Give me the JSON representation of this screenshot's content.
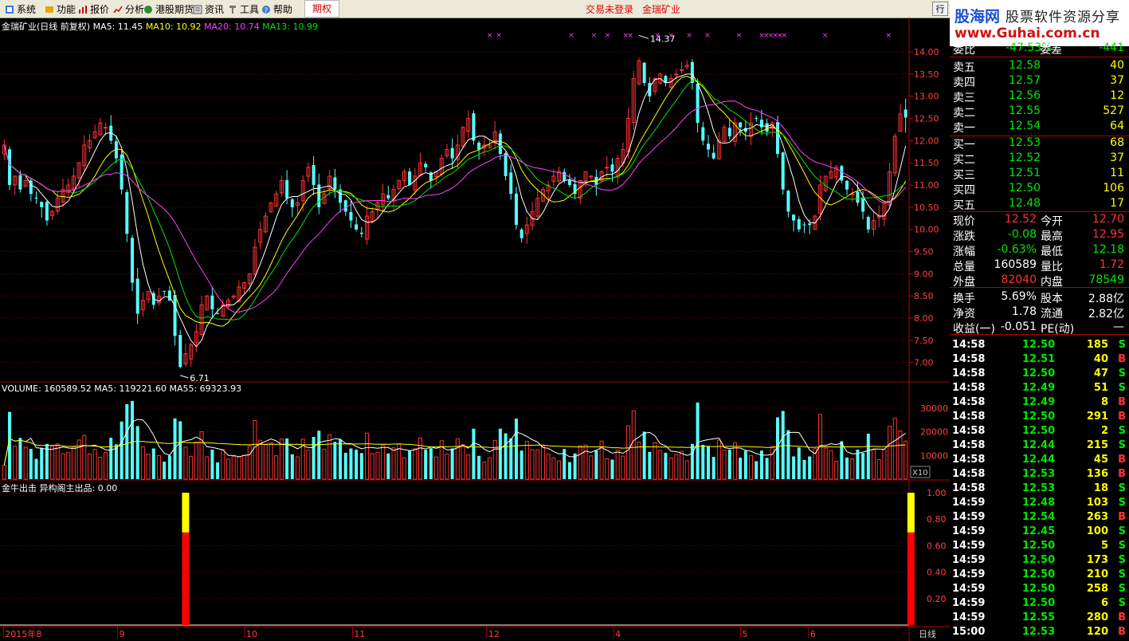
{
  "menu": {
    "items": [
      "系统",
      "功能",
      "报价",
      "分析",
      "港股期货",
      "资讯",
      "工具",
      "帮助"
    ],
    "active": "期权",
    "login_status": "交易未登录",
    "stock_name": "金瑞矿业",
    "top_button": "行"
  },
  "logo": {
    "brand": "股海网",
    "tagline": "股票软件资源分享",
    "url": "www.Guhai.com.cn"
  },
  "colors": {
    "up": "#ff3232",
    "down": "#54ffff",
    "ma5": "#ffffff",
    "ma10": "#ffff00",
    "ma20": "#ff40ff",
    "ma13": "#00e600",
    "grid": "#7a0000"
  },
  "price_panel": {
    "title": "金瑞矿业(日线 前复权)",
    "ma5": "MA5: 11.45",
    "ma10": "MA10: 10.92",
    "ma20": "MA20: 10.74",
    "ma13": "MA13: 10.99",
    "y_ticks": [
      "14.00",
      "13.50",
      "13.00",
      "12.50",
      "12.00",
      "11.50",
      "11.00",
      "10.50",
      "10.00",
      "9.50",
      "9.00",
      "8.50",
      "8.00",
      "7.50",
      "7.00"
    ],
    "y_range": [
      6.6,
      14.45
    ],
    "high_label": "14.37",
    "low_label": "6.71",
    "marker": "×"
  },
  "volume_panel": {
    "title": "VOLUME: 160589.52",
    "ma5": "MA5: 119221.60",
    "ma55": "MA55: 69323.93",
    "y_ticks": [
      "30000",
      "20000",
      "10000"
    ],
    "unit": "X10",
    "y_max": 36000
  },
  "indicator_panel": {
    "title": "金牛出击",
    "subtitle": "异构阁主出品: 0.00",
    "y_ticks": [
      "1.00",
      "0.80",
      "0.60",
      "0.40",
      "0.20"
    ]
  },
  "x_axis": {
    "labels": [
      "2015年8",
      "9",
      "10",
      "11",
      "12",
      "4",
      "5",
      "6"
    ],
    "period": "日线"
  },
  "chart_data": {
    "type": "candlestick",
    "close": [
      11.9,
      11.0,
      11.2,
      10.9,
      11.1,
      10.8,
      10.7,
      10.5,
      10.2,
      10.4,
      10.7,
      10.9,
      11.0,
      11.2,
      11.5,
      11.9,
      12.0,
      12.2,
      12.4,
      12.3,
      12.0,
      11.6,
      10.9,
      9.9,
      8.8,
      8.1,
      8.4,
      8.6,
      8.3,
      8.5,
      8.6,
      8.4,
      7.6,
      6.9,
      7.2,
      7.4,
      7.7,
      8.3,
      8.5,
      8.2,
      8.1,
      8.3,
      8.4,
      8.5,
      8.7,
      8.8,
      9.0,
      9.6,
      10.0,
      10.3,
      10.6,
      10.8,
      11.1,
      10.7,
      10.5,
      10.6,
      11.1,
      11.4,
      11.0,
      10.5,
      10.8,
      11.2,
      10.9,
      10.6,
      10.4,
      10.2,
      10.0,
      9.9,
      10.3,
      10.4,
      10.6,
      10.8,
      10.7,
      10.9,
      11.1,
      11.3,
      11.0,
      11.2,
      11.5,
      11.4,
      11.1,
      11.3,
      11.6,
      11.8,
      11.6,
      11.9,
      12.3,
      12.5,
      12.0,
      11.8,
      11.9,
      11.9,
      12.2,
      11.7,
      11.2,
      10.8,
      10.1,
      9.8,
      10.1,
      10.4,
      10.7,
      10.9,
      11.0,
      11.2,
      11.3,
      11.1,
      11.0,
      10.8,
      11.1,
      11.3,
      11.2,
      11.0,
      11.3,
      11.4,
      11.3,
      11.6,
      11.8,
      12.5,
      13.4,
      13.8,
      13.3,
      13.0,
      13.4,
      13.5,
      13.3,
      13.4,
      13.5,
      13.6,
      13.7,
      13.3,
      12.4,
      12.0,
      11.8,
      11.6,
      12.0,
      12.3,
      12.1,
      12.4,
      12.3,
      12.2,
      12.4,
      12.5,
      12.3,
      12.2,
      12.4,
      11.7,
      10.9,
      10.4,
      10.2,
      10.0,
      10.1,
      10.1,
      10.3,
      11.0,
      11.2,
      11.3,
      11.4,
      11.1,
      10.9,
      10.8,
      10.6,
      10.4,
      10.0,
      10.2,
      10.3,
      10.6,
      11.3,
      12.1,
      12.6,
      12.8
    ],
    "last": {
      "open": 12.7,
      "high": 12.95,
      "low": 12.18,
      "close": 12.52
    },
    "period": "日线",
    "series": [
      {
        "name": "MA5",
        "value": 11.45
      },
      {
        "name": "MA10",
        "value": 10.92
      },
      {
        "name": "MA20",
        "value": 10.74
      },
      {
        "name": "MA13",
        "value": 10.99
      }
    ],
    "volume_series": [
      {
        "name": "VOLUME",
        "value": 160589.52
      },
      {
        "name": "MA5",
        "value": 119221.6
      },
      {
        "name": "MA55",
        "value": 69323.93
      }
    ],
    "indicator_series": [
      {
        "name": "异构阁主出品",
        "value": 0.0,
        "signals": [
          {
            "bar": 34,
            "value": 1.0,
            "yellow_from": 0.7
          },
          {
            "bar": 170,
            "value": 1.0,
            "yellow_from": 0.7
          }
        ]
      }
    ],
    "high_marker": 14.37,
    "low_marker": 6.71
  },
  "quote": {
    "partial_row": {
      "label": "委比",
      "value": "-47.53%",
      "label2": "委差",
      "value2": "-441"
    },
    "asks": [
      {
        "label": "卖五",
        "price": "12.58",
        "vol": "40"
      },
      {
        "label": "卖四",
        "price": "12.57",
        "vol": "37"
      },
      {
        "label": "卖三",
        "price": "12.56",
        "vol": "12"
      },
      {
        "label": "卖二",
        "price": "12.55",
        "vol": "527"
      },
      {
        "label": "卖一",
        "price": "12.54",
        "vol": "64"
      }
    ],
    "bids": [
      {
        "label": "买一",
        "price": "12.53",
        "vol": "68"
      },
      {
        "label": "买二",
        "price": "12.52",
        "vol": "37"
      },
      {
        "label": "买三",
        "price": "12.51",
        "vol": "11"
      },
      {
        "label": "买四",
        "price": "12.50",
        "vol": "106"
      },
      {
        "label": "买五",
        "price": "12.48",
        "vol": "17"
      }
    ],
    "stats": [
      {
        "l1": "现价",
        "v1": "12.52",
        "c1": "red",
        "l2": "今开",
        "v2": "12.70",
        "c2": "red"
      },
      {
        "l1": "涨跌",
        "v1": "-0.08",
        "c1": "green",
        "l2": "最高",
        "v2": "12.95",
        "c2": "red"
      },
      {
        "l1": "涨幅",
        "v1": "-0.63%",
        "c1": "green",
        "l2": "最低",
        "v2": "12.18",
        "c2": "green"
      },
      {
        "l1": "总量",
        "v1": "160589",
        "c1": "white",
        "l2": "量比",
        "v2": "1.72",
        "c2": "red"
      },
      {
        "l1": "外盘",
        "v1": "82040",
        "c1": "red",
        "l2": "内盘",
        "v2": "78549",
        "c2": "green"
      },
      {
        "l1": "换手",
        "v1": "5.69%",
        "c1": "white",
        "l2": "股本",
        "v2": "2.88亿",
        "c2": "white"
      },
      {
        "l1": "净资",
        "v1": "1.78",
        "c1": "white",
        "l2": "流通",
        "v2": "2.82亿",
        "c2": "white"
      },
      {
        "l1": "收益(一)",
        "v1": "-0.051",
        "c1": "white",
        "l2": "PE(动)",
        "v2": "—",
        "c2": "white"
      }
    ]
  },
  "ticks": [
    {
      "time": "14:58",
      "price": "12.50",
      "vol": "185",
      "side": "S"
    },
    {
      "time": "14:58",
      "price": "12.51",
      "vol": "40",
      "side": "B"
    },
    {
      "time": "14:58",
      "price": "12.50",
      "vol": "47",
      "side": "S"
    },
    {
      "time": "14:58",
      "price": "12.49",
      "vol": "51",
      "side": "S"
    },
    {
      "time": "14:58",
      "price": "12.49",
      "vol": "8",
      "side": "B"
    },
    {
      "time": "14:58",
      "price": "12.50",
      "vol": "291",
      "side": "B"
    },
    {
      "time": "14:58",
      "price": "12.50",
      "vol": "2",
      "side": "S"
    },
    {
      "time": "14:58",
      "price": "12.44",
      "vol": "215",
      "side": "S"
    },
    {
      "time": "14:58",
      "price": "12.44",
      "vol": "45",
      "side": "B"
    },
    {
      "time": "14:58",
      "price": "12.53",
      "vol": "136",
      "side": "B"
    },
    {
      "time": "14:58",
      "price": "12.53",
      "vol": "18",
      "side": "S"
    },
    {
      "time": "14:59",
      "price": "12.48",
      "vol": "103",
      "side": "S"
    },
    {
      "time": "14:59",
      "price": "12.54",
      "vol": "263",
      "side": "B"
    },
    {
      "time": "14:59",
      "price": "12.45",
      "vol": "100",
      "side": "S"
    },
    {
      "time": "14:59",
      "price": "12.50",
      "vol": "5",
      "side": "S"
    },
    {
      "time": "14:59",
      "price": "12.50",
      "vol": "173",
      "side": "S"
    },
    {
      "time": "14:59",
      "price": "12.50",
      "vol": "210",
      "side": "S"
    },
    {
      "time": "14:59",
      "price": "12.50",
      "vol": "258",
      "side": "S"
    },
    {
      "time": "14:59",
      "price": "12.50",
      "vol": "6",
      "side": "S"
    },
    {
      "time": "14:59",
      "price": "12.55",
      "vol": "280",
      "side": "B"
    },
    {
      "time": "15:00",
      "price": "12.53",
      "vol": "120",
      "side": "B"
    }
  ]
}
